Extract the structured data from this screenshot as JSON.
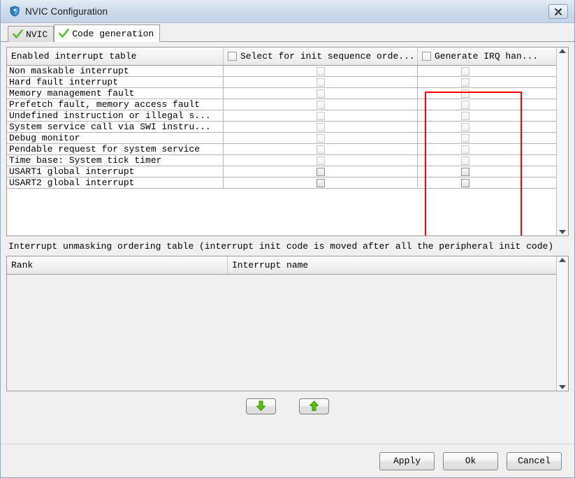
{
  "window": {
    "title": "NVIC Configuration",
    "icon": "shield-icon",
    "close_label": "✕"
  },
  "tabs": [
    {
      "label": "NVIC",
      "active": false,
      "icon": "green-check-icon"
    },
    {
      "label": "Code generation",
      "active": true,
      "icon": "green-check-icon"
    }
  ],
  "enabled_table": {
    "headers": {
      "col1": "Enabled interrupt table",
      "col2": "Select for init sequence orde...",
      "col3": "Generate IRQ han...",
      "col2_checkbox_checked": false,
      "col3_checkbox_checked": false
    },
    "rows": [
      {
        "name": "Non maskable interrupt",
        "select_init": false,
        "generate_irq": false,
        "enabled": false
      },
      {
        "name": "Hard fault interrupt",
        "select_init": false,
        "generate_irq": false,
        "enabled": false
      },
      {
        "name": "Memory management fault",
        "select_init": false,
        "generate_irq": false,
        "enabled": false
      },
      {
        "name": "Prefetch fault, memory access fault",
        "select_init": false,
        "generate_irq": false,
        "enabled": false
      },
      {
        "name": "Undefined instruction or illegal s...",
        "select_init": false,
        "generate_irq": false,
        "enabled": false
      },
      {
        "name": "System service call via SWI instru...",
        "select_init": false,
        "generate_irq": false,
        "enabled": false
      },
      {
        "name": "Debug monitor",
        "select_init": false,
        "generate_irq": false,
        "enabled": false
      },
      {
        "name": "Pendable request for system service",
        "select_init": false,
        "generate_irq": false,
        "enabled": false
      },
      {
        "name": "Time base: System tick timer",
        "select_init": false,
        "generate_irq": false,
        "enabled": false
      },
      {
        "name": "USART1 global interrupt",
        "select_init": false,
        "generate_irq": false,
        "enabled": true
      },
      {
        "name": "USART2 global interrupt",
        "select_init": false,
        "generate_irq": false,
        "enabled": true
      }
    ]
  },
  "ordering": {
    "caption": "Interrupt unmasking ordering table (interrupt init code is moved after all the peripheral init code)",
    "headers": {
      "rank": "Rank",
      "interrupt_name": "Interrupt name"
    },
    "rows": []
  },
  "move_buttons": {
    "down_label": "▼",
    "up_label": "▲"
  },
  "footer": {
    "apply": "Apply",
    "ok": "Ok",
    "cancel": "Cancel"
  },
  "annotation": {
    "highlight_color": "#ff0000",
    "target": "Generate IRQ handler column"
  },
  "colors": {
    "titlebar_top": "#e3ecf5",
    "titlebar_bottom": "#c3d3e6",
    "panel_bg": "#f0f0f0",
    "accent_check": "#5cb82e",
    "highlight": "#ff0000"
  }
}
